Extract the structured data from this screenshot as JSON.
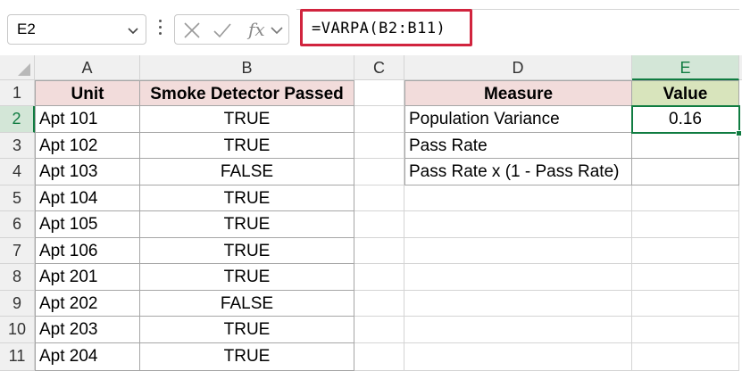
{
  "formula_bar": {
    "name_box": "E2",
    "fx_label": "fx",
    "formula": "=VARPA(B2:B11)"
  },
  "columns": [
    "A",
    "B",
    "C",
    "D",
    "E"
  ],
  "rows": [
    "1",
    "2",
    "3",
    "4",
    "5",
    "6",
    "7",
    "8",
    "9",
    "10",
    "11"
  ],
  "table1": {
    "headers": [
      "Unit",
      "Smoke Detector Passed"
    ],
    "rows": [
      [
        "Apt 101",
        "TRUE"
      ],
      [
        "Apt 102",
        "TRUE"
      ],
      [
        "Apt 103",
        "FALSE"
      ],
      [
        "Apt 104",
        "TRUE"
      ],
      [
        "Apt 105",
        "TRUE"
      ],
      [
        "Apt 106",
        "TRUE"
      ],
      [
        "Apt 201",
        "TRUE"
      ],
      [
        "Apt 202",
        "FALSE"
      ],
      [
        "Apt 203",
        "TRUE"
      ],
      [
        "Apt 204",
        "TRUE"
      ]
    ]
  },
  "table2": {
    "headers": [
      "Measure",
      "Value"
    ],
    "rows": [
      [
        "Population Variance",
        "0.16"
      ],
      [
        "Pass Rate",
        ""
      ],
      [
        "Pass Rate x (1 - Pass Rate)",
        ""
      ]
    ]
  },
  "colors": {
    "accent": "#107c41",
    "header_pink": "#f2dcdb",
    "header_green": "#d8e4bc",
    "formula_highlight": "#d1243e"
  }
}
